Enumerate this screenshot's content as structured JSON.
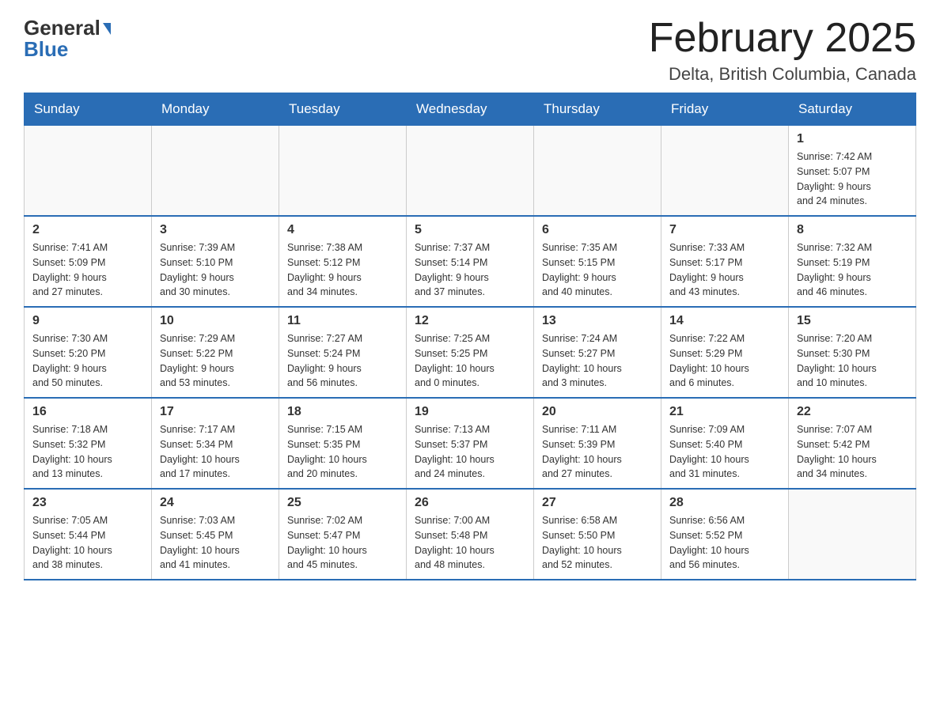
{
  "header": {
    "logo_general": "General",
    "logo_blue": "Blue",
    "title": "February 2025",
    "subtitle": "Delta, British Columbia, Canada"
  },
  "days_of_week": [
    "Sunday",
    "Monday",
    "Tuesday",
    "Wednesday",
    "Thursday",
    "Friday",
    "Saturday"
  ],
  "weeks": [
    [
      {
        "day": "",
        "info": ""
      },
      {
        "day": "",
        "info": ""
      },
      {
        "day": "",
        "info": ""
      },
      {
        "day": "",
        "info": ""
      },
      {
        "day": "",
        "info": ""
      },
      {
        "day": "",
        "info": ""
      },
      {
        "day": "1",
        "info": "Sunrise: 7:42 AM\nSunset: 5:07 PM\nDaylight: 9 hours\nand 24 minutes."
      }
    ],
    [
      {
        "day": "2",
        "info": "Sunrise: 7:41 AM\nSunset: 5:09 PM\nDaylight: 9 hours\nand 27 minutes."
      },
      {
        "day": "3",
        "info": "Sunrise: 7:39 AM\nSunset: 5:10 PM\nDaylight: 9 hours\nand 30 minutes."
      },
      {
        "day": "4",
        "info": "Sunrise: 7:38 AM\nSunset: 5:12 PM\nDaylight: 9 hours\nand 34 minutes."
      },
      {
        "day": "5",
        "info": "Sunrise: 7:37 AM\nSunset: 5:14 PM\nDaylight: 9 hours\nand 37 minutes."
      },
      {
        "day": "6",
        "info": "Sunrise: 7:35 AM\nSunset: 5:15 PM\nDaylight: 9 hours\nand 40 minutes."
      },
      {
        "day": "7",
        "info": "Sunrise: 7:33 AM\nSunset: 5:17 PM\nDaylight: 9 hours\nand 43 minutes."
      },
      {
        "day": "8",
        "info": "Sunrise: 7:32 AM\nSunset: 5:19 PM\nDaylight: 9 hours\nand 46 minutes."
      }
    ],
    [
      {
        "day": "9",
        "info": "Sunrise: 7:30 AM\nSunset: 5:20 PM\nDaylight: 9 hours\nand 50 minutes."
      },
      {
        "day": "10",
        "info": "Sunrise: 7:29 AM\nSunset: 5:22 PM\nDaylight: 9 hours\nand 53 minutes."
      },
      {
        "day": "11",
        "info": "Sunrise: 7:27 AM\nSunset: 5:24 PM\nDaylight: 9 hours\nand 56 minutes."
      },
      {
        "day": "12",
        "info": "Sunrise: 7:25 AM\nSunset: 5:25 PM\nDaylight: 10 hours\nand 0 minutes."
      },
      {
        "day": "13",
        "info": "Sunrise: 7:24 AM\nSunset: 5:27 PM\nDaylight: 10 hours\nand 3 minutes."
      },
      {
        "day": "14",
        "info": "Sunrise: 7:22 AM\nSunset: 5:29 PM\nDaylight: 10 hours\nand 6 minutes."
      },
      {
        "day": "15",
        "info": "Sunrise: 7:20 AM\nSunset: 5:30 PM\nDaylight: 10 hours\nand 10 minutes."
      }
    ],
    [
      {
        "day": "16",
        "info": "Sunrise: 7:18 AM\nSunset: 5:32 PM\nDaylight: 10 hours\nand 13 minutes."
      },
      {
        "day": "17",
        "info": "Sunrise: 7:17 AM\nSunset: 5:34 PM\nDaylight: 10 hours\nand 17 minutes."
      },
      {
        "day": "18",
        "info": "Sunrise: 7:15 AM\nSunset: 5:35 PM\nDaylight: 10 hours\nand 20 minutes."
      },
      {
        "day": "19",
        "info": "Sunrise: 7:13 AM\nSunset: 5:37 PM\nDaylight: 10 hours\nand 24 minutes."
      },
      {
        "day": "20",
        "info": "Sunrise: 7:11 AM\nSunset: 5:39 PM\nDaylight: 10 hours\nand 27 minutes."
      },
      {
        "day": "21",
        "info": "Sunrise: 7:09 AM\nSunset: 5:40 PM\nDaylight: 10 hours\nand 31 minutes."
      },
      {
        "day": "22",
        "info": "Sunrise: 7:07 AM\nSunset: 5:42 PM\nDaylight: 10 hours\nand 34 minutes."
      }
    ],
    [
      {
        "day": "23",
        "info": "Sunrise: 7:05 AM\nSunset: 5:44 PM\nDaylight: 10 hours\nand 38 minutes."
      },
      {
        "day": "24",
        "info": "Sunrise: 7:03 AM\nSunset: 5:45 PM\nDaylight: 10 hours\nand 41 minutes."
      },
      {
        "day": "25",
        "info": "Sunrise: 7:02 AM\nSunset: 5:47 PM\nDaylight: 10 hours\nand 45 minutes."
      },
      {
        "day": "26",
        "info": "Sunrise: 7:00 AM\nSunset: 5:48 PM\nDaylight: 10 hours\nand 48 minutes."
      },
      {
        "day": "27",
        "info": "Sunrise: 6:58 AM\nSunset: 5:50 PM\nDaylight: 10 hours\nand 52 minutes."
      },
      {
        "day": "28",
        "info": "Sunrise: 6:56 AM\nSunset: 5:52 PM\nDaylight: 10 hours\nand 56 minutes."
      },
      {
        "day": "",
        "info": ""
      }
    ]
  ]
}
